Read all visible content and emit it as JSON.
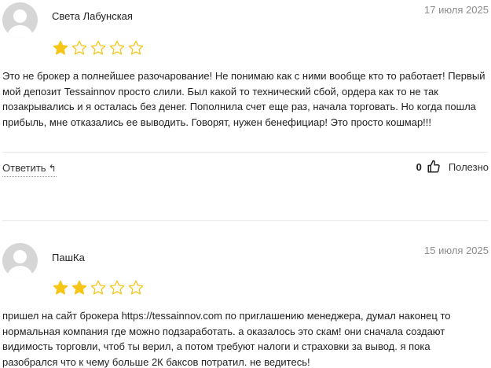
{
  "reviews": [
    {
      "author": "Света Лабунская",
      "date": "17 июля 2025",
      "rating": 1,
      "max_rating": 5,
      "text": "Это не брокер а полнейшее разочарование! Не понимаю как с ними вообще кто то работает! Первый мой депозит Tessainnov просто слили. Был какой то технический сбой, ордера как то не так позакрывались и я осталась без денег. Пополнила счет еще раз, начала торговать. Но когда пошла прибыль, мне отказались ее выводить. Говорят, нужен бенефициар! Это просто кошмар!!!",
      "reply_label": "Ответить",
      "helpful_count": "0",
      "helpful_label": "Полезно"
    },
    {
      "author": "ПашКа",
      "date": "15 июля 2025",
      "rating": 2,
      "max_rating": 5,
      "text": "пришел на сайт брокера https://tessainnov.com по приглашению менеджера, думал наконец то нормальная компания где можно подзаработать. а оказалось это скам! они сначала создают видимость торговли, чтоб ты верил, а потом требуют налоги и страховки за вывод. я пока разобрался что к чему больше 2К баксов потратил. не ведитесь!"
    }
  ],
  "colors": {
    "star_filled": "#f5c518",
    "star_outline": "#f5c518",
    "date": "#8c8c8c",
    "avatar_bg": "#d6d6d6"
  },
  "icons": {
    "star": "star-icon",
    "reply": "reply-arrow-icon",
    "helpful": "thumbs-up-icon",
    "avatar": "user-avatar-icon"
  }
}
